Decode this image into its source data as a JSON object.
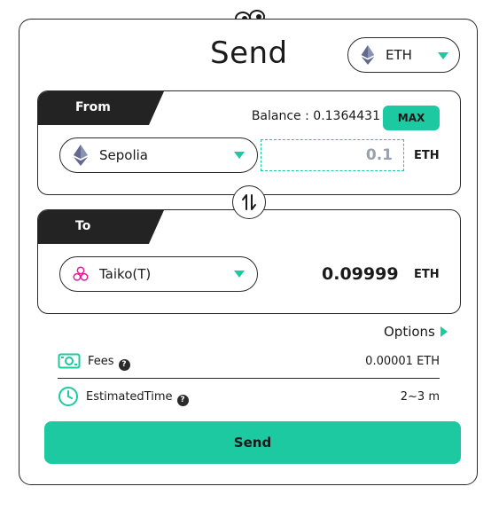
{
  "header": {
    "title": "Send"
  },
  "token_select": {
    "label": "ETH",
    "icon": "ethereum-icon"
  },
  "from": {
    "tab_label": "From",
    "balance": "Balance : 0.1364431",
    "max_label": "MAX",
    "network": "Sepolia",
    "amount_value": "0.1",
    "unit": "ETH"
  },
  "to": {
    "tab_label": "To",
    "network": "Taiko(T)",
    "amount": "0.09999",
    "unit": "ETH"
  },
  "options_label": "Options",
  "fees": {
    "label": "Fees",
    "value": "0.00001 ETH"
  },
  "time": {
    "label": "EstimatedTime",
    "value": "2~3 m"
  },
  "help_glyph": "?",
  "send_label": "Send",
  "colors": {
    "accent": "#1cc9a0",
    "dark": "#232323",
    "taiko_pink": "#e81899"
  }
}
